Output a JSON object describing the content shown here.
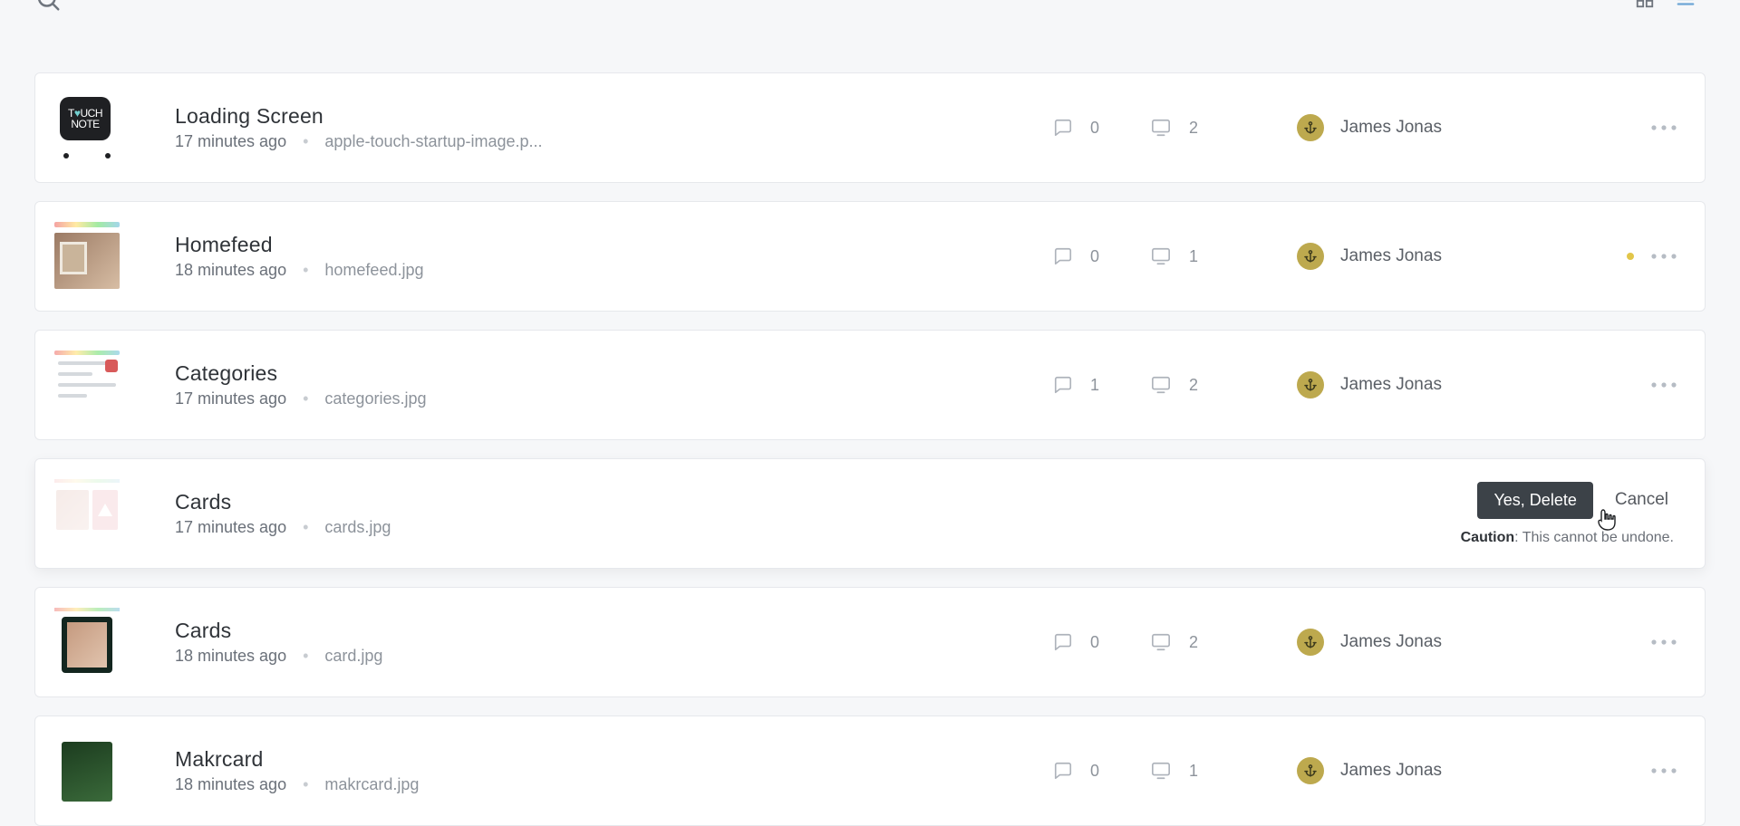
{
  "confirm": {
    "delete_label": "Yes, Delete",
    "cancel_label": "Cancel",
    "caution_label": "Caution",
    "caution_text": ": This cannot be undone."
  },
  "items": [
    {
      "title": "Loading Screen",
      "time": "17 minutes ago",
      "file": "apple-touch-startup-image.p...",
      "comments": "0",
      "versions": "2",
      "author": "James Jonas",
      "status": false,
      "deleting": false,
      "thumb": "touchnote"
    },
    {
      "title": "Homefeed",
      "time": "18 minutes ago",
      "file": "homefeed.jpg",
      "comments": "0",
      "versions": "1",
      "author": "James Jonas",
      "status": true,
      "deleting": false,
      "thumb": "homefeed"
    },
    {
      "title": "Categories",
      "time": "17 minutes ago",
      "file": "categories.jpg",
      "comments": "1",
      "versions": "2",
      "author": "James Jonas",
      "status": false,
      "deleting": false,
      "thumb": "categories"
    },
    {
      "title": "Cards",
      "time": "17 minutes ago",
      "file": "cards.jpg",
      "comments": "",
      "versions": "",
      "author": "",
      "status": false,
      "deleting": true,
      "thumb": "cards1"
    },
    {
      "title": "Cards",
      "time": "18 minutes ago",
      "file": "card.jpg",
      "comments": "0",
      "versions": "2",
      "author": "James Jonas",
      "status": false,
      "deleting": false,
      "thumb": "cards2"
    },
    {
      "title": "Makrcard",
      "time": "18 minutes ago",
      "file": "makrcard.jpg",
      "comments": "0",
      "versions": "1",
      "author": "James Jonas",
      "status": false,
      "deleting": false,
      "thumb": "makrcard"
    }
  ]
}
